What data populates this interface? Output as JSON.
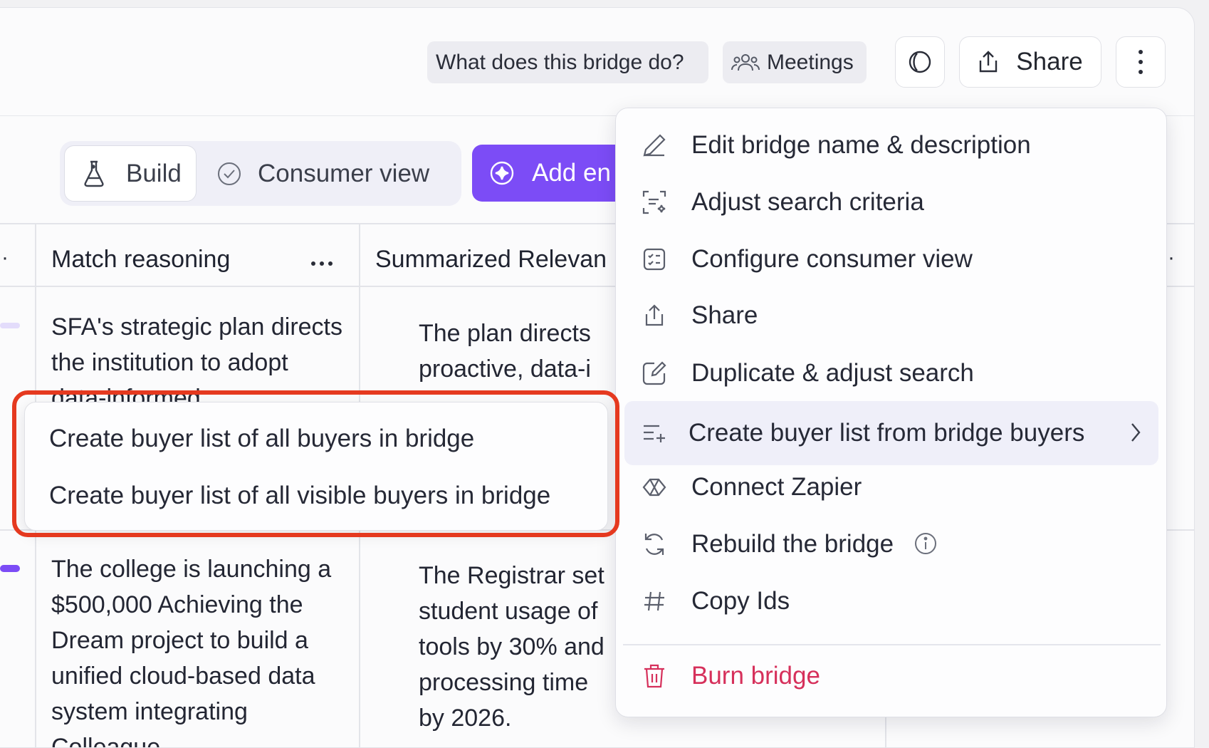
{
  "header": {
    "what_does_label": "What does this bridge do?",
    "meetings_label": "Meetings",
    "share_label": "Share"
  },
  "toolbar": {
    "build_label": "Build",
    "consumer_view_label": "Consumer view",
    "add_label": "Add en"
  },
  "table": {
    "columns": [
      "Match reasoning",
      "Summarized Relevan"
    ],
    "rows": [
      {
        "match_reasoning": "SFA's strategic plan directs the institution to adopt data-informed",
        "summary": [
          "The plan directs proactive, data-i"
        ]
      },
      {
        "match_reasoning": "The college is launching a $500,000 Achieving the Dream project to build a unified cloud-based data system integrating Colleague",
        "summary": [
          "The Registrar set student usage of tools by 30% and processing time by 2026."
        ]
      }
    ]
  },
  "menu": {
    "items": [
      {
        "label": "Edit bridge name & description",
        "icon": "pencil-icon"
      },
      {
        "label": "Adjust search criteria",
        "icon": "scan-sparkle-icon"
      },
      {
        "label": "Configure consumer view",
        "icon": "checklist-icon"
      },
      {
        "label": "Share",
        "icon": "share-icon"
      },
      {
        "label": "Duplicate & adjust search",
        "icon": "duplicate-edit-icon"
      },
      {
        "label": "Create buyer list from bridge buyers",
        "icon": "list-add-icon"
      },
      {
        "label": "Connect Zapier",
        "icon": "zapier-icon"
      },
      {
        "label": "Rebuild the bridge",
        "icon": "refresh-icon"
      },
      {
        "label": "Copy Ids",
        "icon": "hash-icon"
      },
      {
        "label": "Burn bridge",
        "icon": "trash-icon"
      }
    ]
  },
  "submenu": {
    "items": [
      "Create buyer list of all buyers in bridge",
      "Create buyer list of all visible buyers in bridge"
    ]
  },
  "colors": {
    "accent": "#7c4cf6",
    "danger": "#d6305b",
    "highlight": "#e5391f"
  }
}
